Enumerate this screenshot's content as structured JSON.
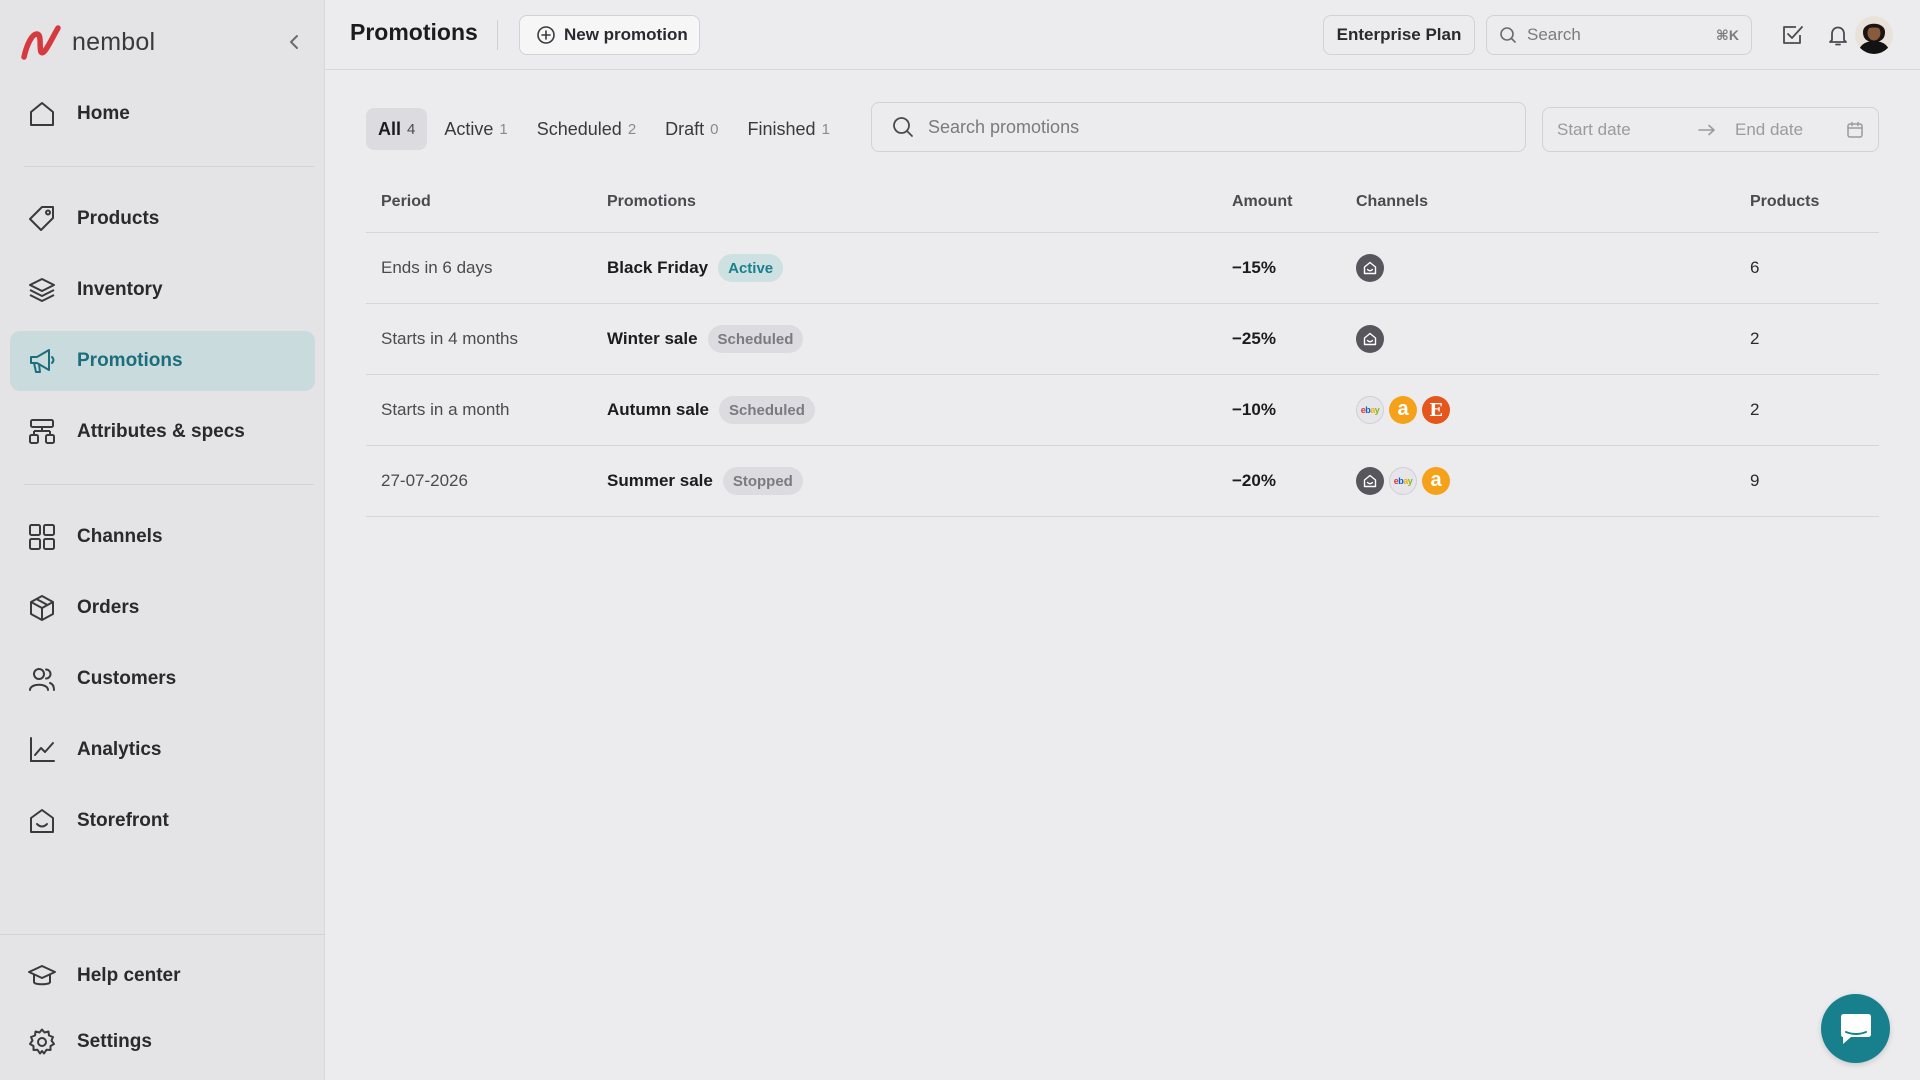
{
  "app": {
    "brand": "nembol"
  },
  "sidebar": {
    "home": "Home",
    "products": "Products",
    "inventory": "Inventory",
    "promotions": "Promotions",
    "attributes": "Attributes & specs",
    "channels": "Channels",
    "orders": "Orders",
    "customers": "Customers",
    "analytics": "Analytics",
    "storefront": "Storefront",
    "help": "Help center",
    "settings": "Settings"
  },
  "header": {
    "title": "Promotions",
    "new_promotion": "New promotion",
    "plan": "Enterprise Plan",
    "search_placeholder": "Search",
    "search_shortcut": "⌘K"
  },
  "filters": {
    "tabs": [
      {
        "label": "All",
        "count": "4",
        "active": true
      },
      {
        "label": "Active",
        "count": "1"
      },
      {
        "label": "Scheduled",
        "count": "2"
      },
      {
        "label": "Draft",
        "count": "0"
      },
      {
        "label": "Finished",
        "count": "1"
      }
    ],
    "search_placeholder": "Search promotions",
    "start_date": "Start date",
    "end_date": "End date"
  },
  "table": {
    "columns": {
      "period": "Period",
      "promotions": "Promotions",
      "amount": "Amount",
      "channels": "Channels",
      "products": "Products"
    },
    "rows": [
      {
        "period": "Ends in 6 days",
        "name": "Black Friday",
        "status": "Active",
        "amount": "−15%",
        "channels": [
          "storefront"
        ],
        "products": "6"
      },
      {
        "period": "Starts in 4 months",
        "name": "Winter sale",
        "status": "Scheduled",
        "amount": "−25%",
        "channels": [
          "storefront"
        ],
        "products": "2"
      },
      {
        "period": "Starts in a month",
        "name": "Autumn sale",
        "status": "Scheduled",
        "amount": "−10%",
        "channels": [
          "ebay",
          "amazon",
          "etsy"
        ],
        "products": "2"
      },
      {
        "period": "27-07-2026",
        "name": "Summer sale",
        "status": "Stopped",
        "amount": "−20%",
        "channels": [
          "storefront",
          "ebay",
          "amazon"
        ],
        "products": "9"
      }
    ]
  },
  "channel_glyphs": {
    "amazon": "a",
    "etsy": "E",
    "ebay": "ebay"
  },
  "colors": {
    "accent": "#17808c",
    "brand": "#d63a3f",
    "active_badge_bg": "#cde0e2",
    "active_badge_text": "#1b7f8c"
  }
}
